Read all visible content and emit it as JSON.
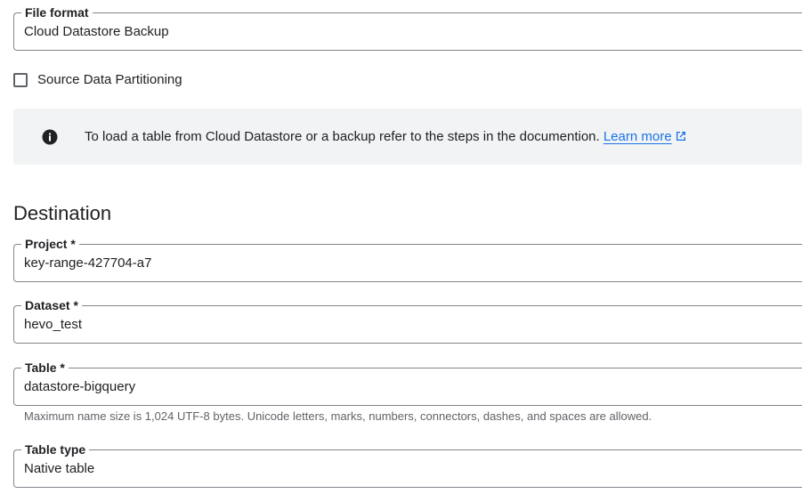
{
  "file_format": {
    "label": "File format",
    "value": "Cloud Datastore Backup"
  },
  "source_partitioning": {
    "label": "Source Data Partitioning",
    "checked": false
  },
  "info_banner": {
    "icon": "info-icon",
    "text": "To load a table from Cloud Datastore or a backup refer to the steps in the documention.",
    "link_label": "Learn more",
    "link_icon": "external-link-icon"
  },
  "destination": {
    "heading": "Destination",
    "project": {
      "label": "Project *",
      "value": "key-range-427704-a7"
    },
    "dataset": {
      "label": "Dataset *",
      "value": "hevo_test"
    },
    "table": {
      "label": "Table *",
      "value": "datastore-bigquery",
      "hint": "Maximum name size is 1,024 UTF-8 bytes. Unicode letters, marks, numbers, connectors, dashes, and spaces are allowed."
    },
    "table_type": {
      "label": "Table type",
      "value": "Native table"
    }
  },
  "colors": {
    "link": "#1a73e8",
    "banner_bg": "#f1f3f4",
    "border": "#80868b",
    "hint_text": "#5f6368"
  }
}
